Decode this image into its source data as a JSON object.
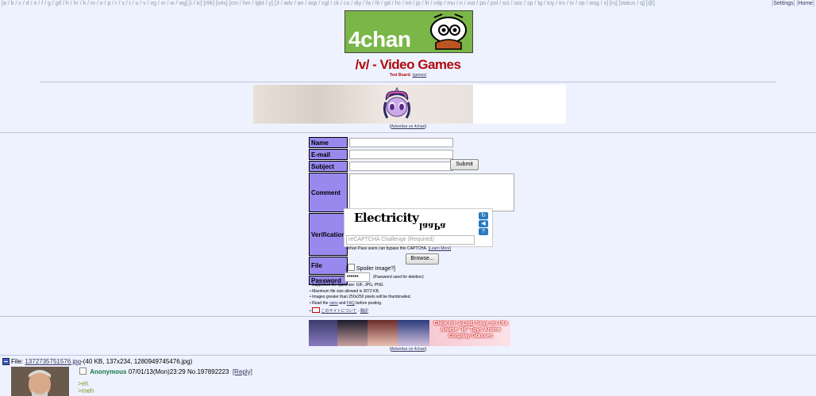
{
  "nav": {
    "boards_left": "[a / b / c / d / e / f / g / gif / h / hr / k / m / o / p / r / s / t / u / v / vg / vr / w / wg] [i / ic] [r9k] [s4s] [cm / hm / lgbt / y] [3 / adv / an / asp / cgl / ck / co / diy / fa / fit / gd / hc / int / jp / lit / mlp / mu / n / out / po / pol / sci / soc / sp / tg / toy / trv / tv / vp / wsg / x] [rs] [status / q] [@]",
    "settings": "Settings",
    "home": "Home"
  },
  "banner": {
    "text": "4chan"
  },
  "board": {
    "title": "/v/ - Video Games",
    "textboard_label": "Text Board:",
    "textboard_link": "/games/"
  },
  "ads": {
    "advertise": "Advertise on 4chan"
  },
  "form": {
    "name_label": "Name",
    "email_label": "E-mail",
    "subject_label": "Subject",
    "comment_label": "Comment",
    "verification_label": "Verification",
    "file_label": "File",
    "password_label": "Password",
    "submit": "Submit",
    "browse": "Browse...",
    "spoiler": "Spoiler Image?]",
    "password_value": "••••••",
    "password_note": "(Password used for deletion)"
  },
  "captcha": {
    "word1": "Electricity",
    "word2": "laaPa",
    "placeholder": "reCAPTCHA Challenge (Required)",
    "pass_note": "4chan Pass users can bypass this CAPTCHA.",
    "learn_more": "[Learn More]"
  },
  "rules": {
    "r1": "• Supported file types are: GIF, JPG, PNG",
    "r2": "• Maximum file size allowed is 3072 KB.",
    "r3": "• Images greater than 250x250 pixels will be thumbnailed.",
    "r4_pre": "• Read the ",
    "r4_rules": "rules",
    "r4_mid": " and ",
    "r4_faq": "FAQ",
    "r4_post": " before posting.",
    "r5_pre": "• ",
    "r5_jp": "このサイトについて",
    "r5_sep": " - ",
    "r5_tr": "翻訳"
  },
  "ad2": {
    "text": "Click for J-List! Saya no Uta Anime \"H\" Toys Anime Cosplay Glasses"
  },
  "thread": {
    "file_label": "File: ",
    "file_name": "1372735751576.jpg",
    "file_meta": "-(40 KB, 137x234, 1280949745476.jpg)",
    "name": "Anonymous",
    "datetime": "07/01/13(Mon)23:29",
    "post_no": "No.197892223",
    "reply": "[Reply]",
    "quote1": ">eh",
    "quote2": ">meh"
  }
}
